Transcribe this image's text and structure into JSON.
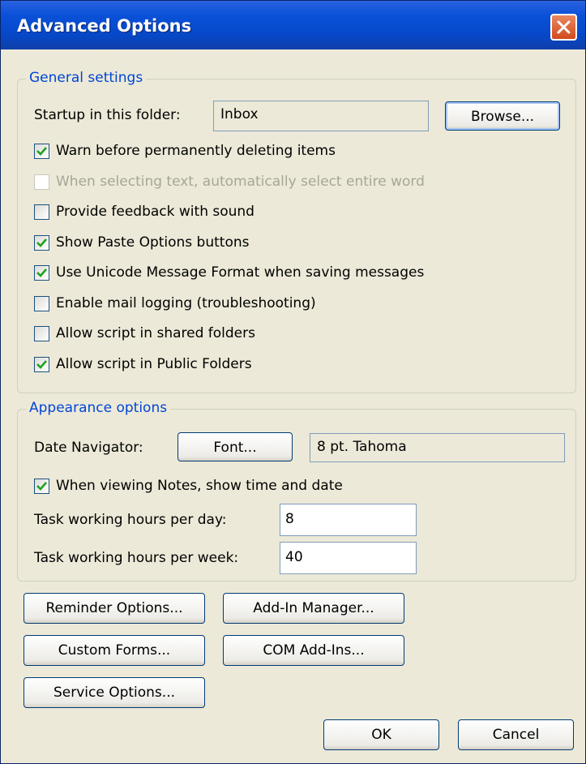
{
  "window": {
    "title": "Advanced Options",
    "close_label": "×"
  },
  "general": {
    "legend": "General settings",
    "startup_label": "Startup in this folder:",
    "startup_value": "Inbox",
    "browse_label": "Browse...",
    "checks": [
      {
        "label": "Warn before permanently deleting items",
        "checked": true,
        "enabled": true
      },
      {
        "label": "When selecting text, automatically select entire word",
        "checked": false,
        "enabled": false
      },
      {
        "label": "Provide feedback with sound",
        "checked": false,
        "enabled": true
      },
      {
        "label": "Show Paste Options buttons",
        "checked": true,
        "enabled": true
      },
      {
        "label": "Use Unicode Message Format when saving messages",
        "checked": true,
        "enabled": true
      },
      {
        "label": "Enable mail logging (troubleshooting)",
        "checked": false,
        "enabled": true
      },
      {
        "label": "Allow script in shared folders",
        "checked": false,
        "enabled": true
      },
      {
        "label": "Allow script in Public Folders",
        "checked": true,
        "enabled": true
      }
    ]
  },
  "appearance": {
    "legend": "Appearance options",
    "date_nav_label": "Date Navigator:",
    "font_button": "Font...",
    "font_value": "8 pt. Tahoma",
    "notes_check": {
      "label": "When viewing Notes, show time and date",
      "checked": true
    },
    "hours_day_label": "Task working hours per day:",
    "hours_day_value": "8",
    "hours_week_label": "Task working hours per week:",
    "hours_week_value": "40"
  },
  "buttons": {
    "reminder": "Reminder Options...",
    "addin_manager": "Add-In Manager...",
    "custom_forms": "Custom Forms...",
    "com_addins": "COM Add-Ins...",
    "service": "Service Options...",
    "ok": "OK",
    "cancel": "Cancel"
  },
  "colors": {
    "titlebar": "#0a51d8",
    "legend": "#0046d5",
    "check": "#21a121",
    "face": "#ece9d8"
  }
}
